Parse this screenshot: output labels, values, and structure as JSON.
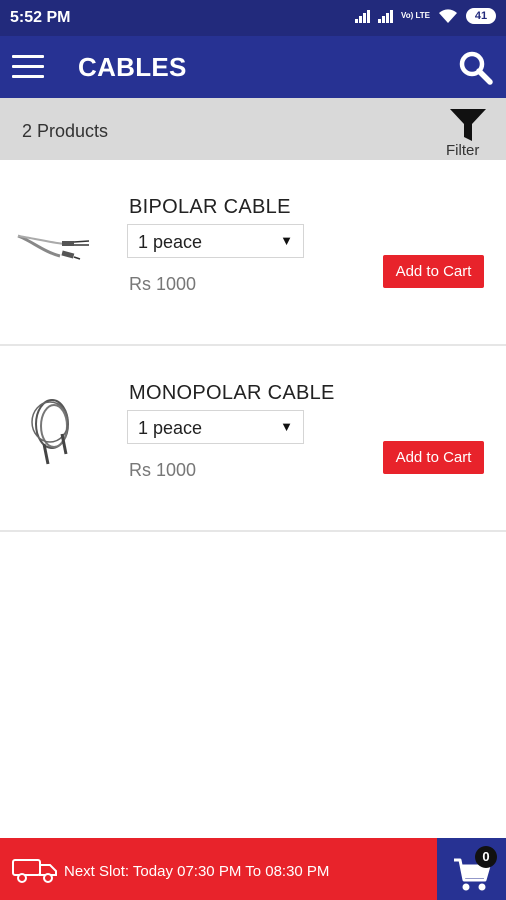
{
  "status_bar": {
    "time": "5:52 PM",
    "network_label": "Vo) LTE",
    "battery": "41"
  },
  "toolbar": {
    "title": "CABLES",
    "menu_icon": "hamburger-menu-icon",
    "search_icon": "search-icon"
  },
  "subbar": {
    "count_text": "2 Products",
    "filter_label": "Filter"
  },
  "products": [
    {
      "name": "BIPOLAR CABLE",
      "quantity": "1 peace",
      "price": "Rs 1000",
      "add_label": "Add to Cart"
    },
    {
      "name": "MONOPOLAR CABLE",
      "quantity": "1 peace",
      "price": "Rs 1000",
      "add_label": "Add to Cart"
    }
  ],
  "bottom_bar": {
    "slot_text": "Next Slot: Today 07:30 PM To 08:30 PM",
    "cart_count": "0"
  },
  "colors": {
    "primary": "#273293",
    "accent": "#e8232b",
    "subbar": "#d9d9d9"
  }
}
